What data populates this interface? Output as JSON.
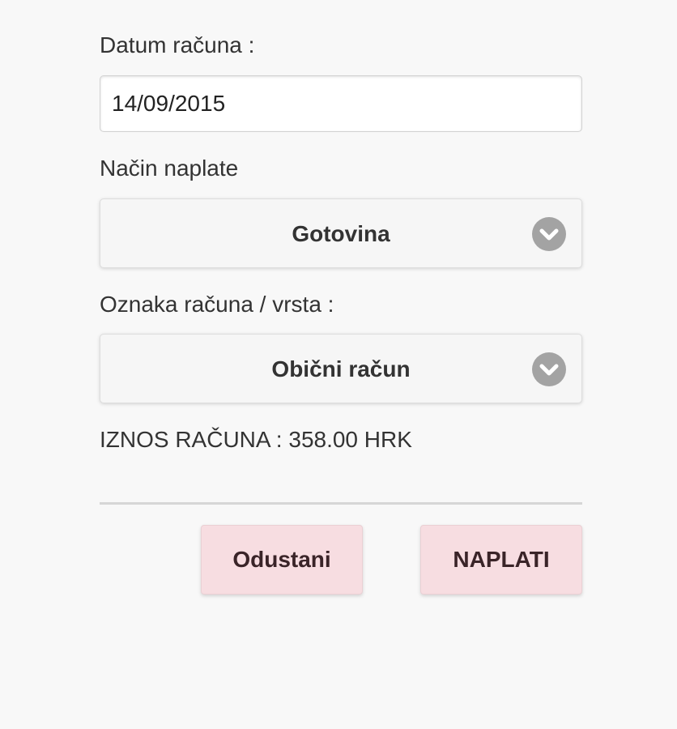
{
  "invoice_date": {
    "label": "Datum računa :",
    "value": "14/09/2015"
  },
  "payment_method": {
    "label": "Način naplate",
    "selected": "Gotovina",
    "icon": "chevron-down-icon"
  },
  "invoice_type": {
    "label": "Oznaka računa / vrsta :",
    "selected": "Obični račun",
    "icon": "chevron-down-icon"
  },
  "amount": {
    "text": "IZNOS RAČUNA : 358.00 HRK"
  },
  "actions": {
    "cancel_label": "Odustani",
    "charge_label": "NAPLATI"
  },
  "colors": {
    "background": "#f8f8f8",
    "button_background": "#f7dde1",
    "chevron_circle": "#a3a3a3"
  }
}
